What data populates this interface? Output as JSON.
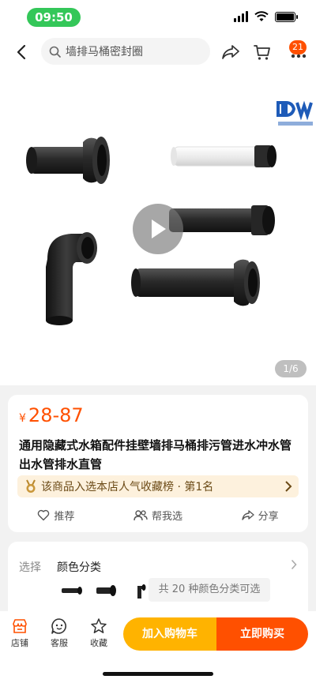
{
  "status_bar": {
    "time": "09:50"
  },
  "header": {
    "search_placeholder": "墙排马桶密封圈",
    "cart_badge": "21"
  },
  "gallery": {
    "page_indicator": "1/6"
  },
  "product": {
    "currency": "¥",
    "price": "28-87",
    "title": "通用隐藏式水箱配件挂壁墙排马桶排污管进水冲水管出水管排水直管",
    "rank_text": "该商品入选本店人气收藏榜 · 第1名"
  },
  "actions": {
    "recommend": "推荐",
    "help_choose": "帮我选",
    "share": "分享"
  },
  "options": {
    "label": "选择",
    "name": "颜色分类",
    "more_text": "共 20 种颜色分类可选"
  },
  "bottom_nav": {
    "store": "店铺",
    "service": "客服",
    "favorite": "收藏",
    "add_cart": "加入购物车",
    "buy_now": "立即购买"
  },
  "colors": {
    "accent": "#ff5000",
    "cart_button": "#ffb300",
    "time_pill": "#34c759"
  },
  "icons": [
    "back-arrow-icon",
    "search-icon",
    "share-icon",
    "cart-icon",
    "more-icon",
    "play-icon",
    "medal-icon",
    "heart-icon",
    "people-icon",
    "share-arrow-icon",
    "store-icon",
    "service-icon",
    "star-icon"
  ]
}
